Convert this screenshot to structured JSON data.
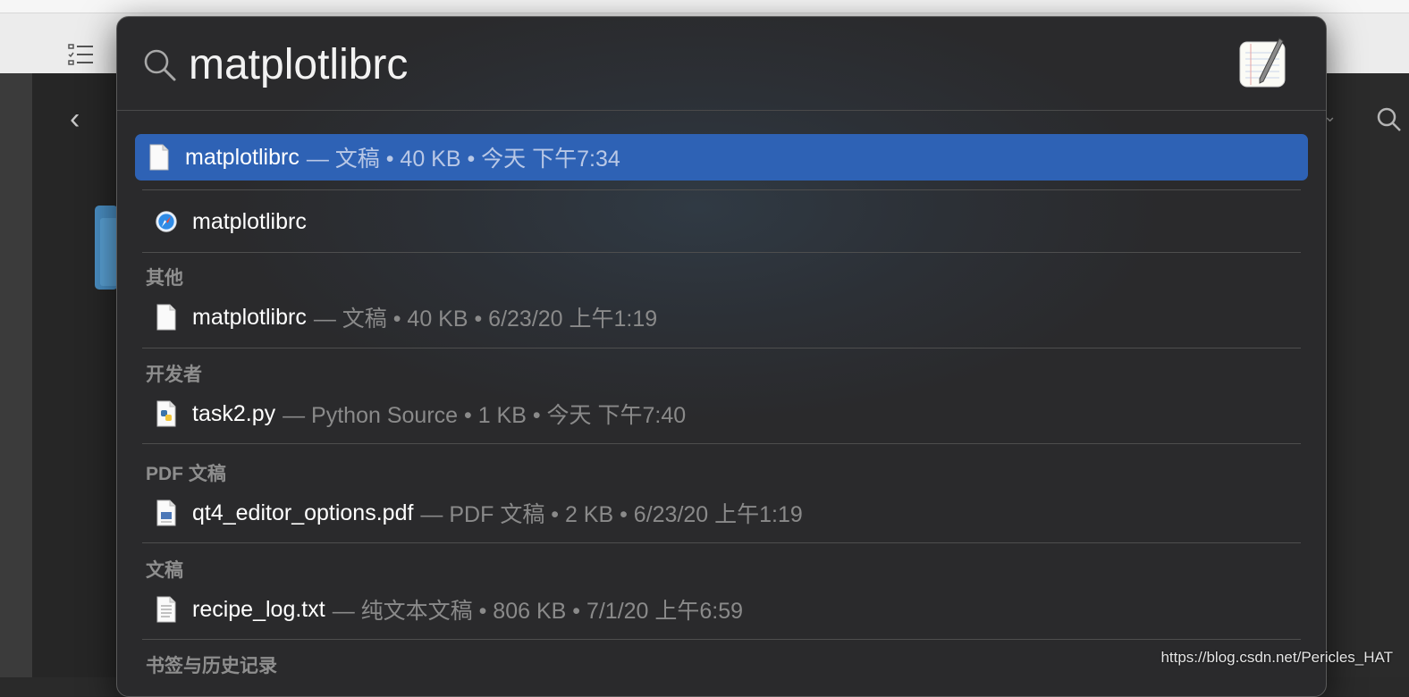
{
  "search": {
    "query": "matplotlibrc"
  },
  "top_hit": {
    "name": "matplotlibrc",
    "meta": "— 文稿 • 40 KB • 今天 下午7:34",
    "icon": "document-icon"
  },
  "suggestion": {
    "name": "matplotlibrc",
    "icon": "safari-icon"
  },
  "sections": [
    {
      "title": "其他",
      "items": [
        {
          "name": "matplotlibrc",
          "meta": "— 文稿 • 40 KB • 6/23/20 上午1:19",
          "icon": "document-icon"
        }
      ]
    },
    {
      "title": "开发者",
      "items": [
        {
          "name": "task2.py",
          "meta": "— Python Source • 1 KB • 今天 下午7:40",
          "icon": "python-file-icon"
        }
      ]
    },
    {
      "title": "PDF 文稿",
      "items": [
        {
          "name": "qt4_editor_options.pdf",
          "meta": "— PDF 文稿 • 2 KB • 6/23/20 上午1:19",
          "icon": "pdf-file-icon"
        }
      ]
    },
    {
      "title": "文稿",
      "items": [
        {
          "name": "recipe_log.txt",
          "meta": "— 纯文本文稿 • 806 KB • 7/1/20 上午6:59",
          "icon": "text-file-icon"
        }
      ]
    },
    {
      "title": "书签与历史记录",
      "items": []
    }
  ],
  "watermark": "https://blog.csdn.net/Pericles_HAT",
  "colors": {
    "selection": "#2e62b5",
    "panel": "#2a2a2c"
  }
}
